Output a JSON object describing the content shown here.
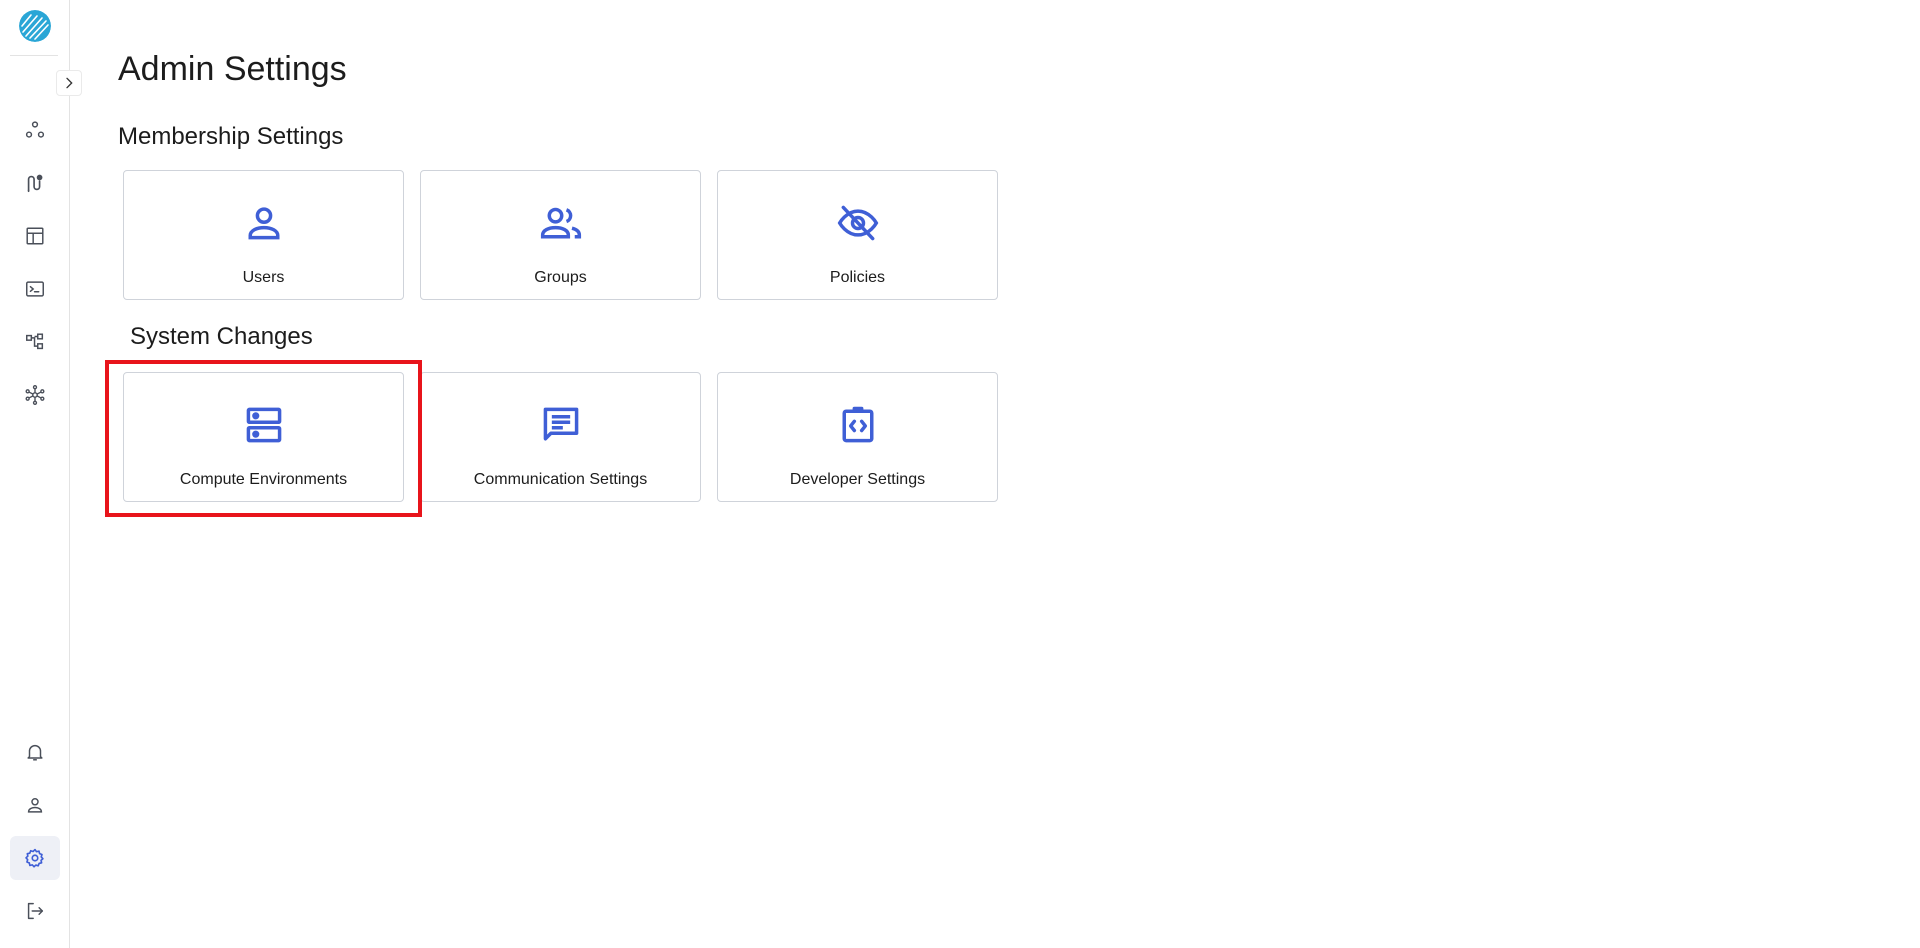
{
  "page": {
    "title": "Admin Settings"
  },
  "sections": [
    {
      "title": "Membership Settings",
      "cards": [
        {
          "label": "Users",
          "icon": "user-icon"
        },
        {
          "label": "Groups",
          "icon": "groups-icon"
        },
        {
          "label": "Policies",
          "icon": "eye-off-icon"
        }
      ]
    },
    {
      "title": "System Changes",
      "cards": [
        {
          "label": "Compute Environments",
          "icon": "server-icon"
        },
        {
          "label": "Communication Settings",
          "icon": "chat-icon"
        },
        {
          "label": "Developer Settings",
          "icon": "code-clipboard-icon"
        }
      ]
    }
  ],
  "sidebar": {
    "top_items": [
      "connections-icon",
      "pipeline-icon",
      "table-icon",
      "terminal-icon",
      "workflow-icon",
      "network-icon"
    ],
    "bottom_items": [
      "bell-icon",
      "user-icon",
      "gear-icon",
      "logout-icon"
    ],
    "active_item": "gear-icon"
  },
  "highlight": {
    "target": "Compute Environments",
    "color": "#e8141b"
  },
  "colors": {
    "accent": "#3f5fd6",
    "icon_gray": "#4a4f59",
    "card_border": "#cfd3da",
    "logo": "#2aa6d6"
  }
}
